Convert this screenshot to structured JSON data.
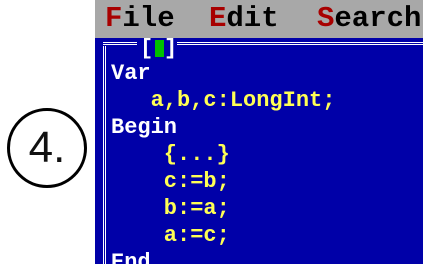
{
  "step_label": "4.",
  "menu": {
    "file": {
      "hotkey": "F",
      "rest": "ile"
    },
    "edit": {
      "hotkey": "E",
      "rest": "dit"
    },
    "search": {
      "hotkey": "S",
      "rest": "earch"
    }
  },
  "window": {
    "title_left": "[",
    "title_right": "]"
  },
  "code": {
    "line1": "Var",
    "line2": "   a,b,c:LongInt;",
    "line3": "Begin",
    "line4": "    {...}",
    "line5": "    c:=b;",
    "line6": "    b:=a;",
    "line7": "    a:=c;",
    "line8": "End."
  },
  "colors": {
    "editor_bg": "#0000a8",
    "menubar_bg": "#a8a8a8",
    "hotkey": "#a80000",
    "keyword": "#ffffff",
    "code_text": "#ffff54",
    "close_button": "#00c000"
  }
}
